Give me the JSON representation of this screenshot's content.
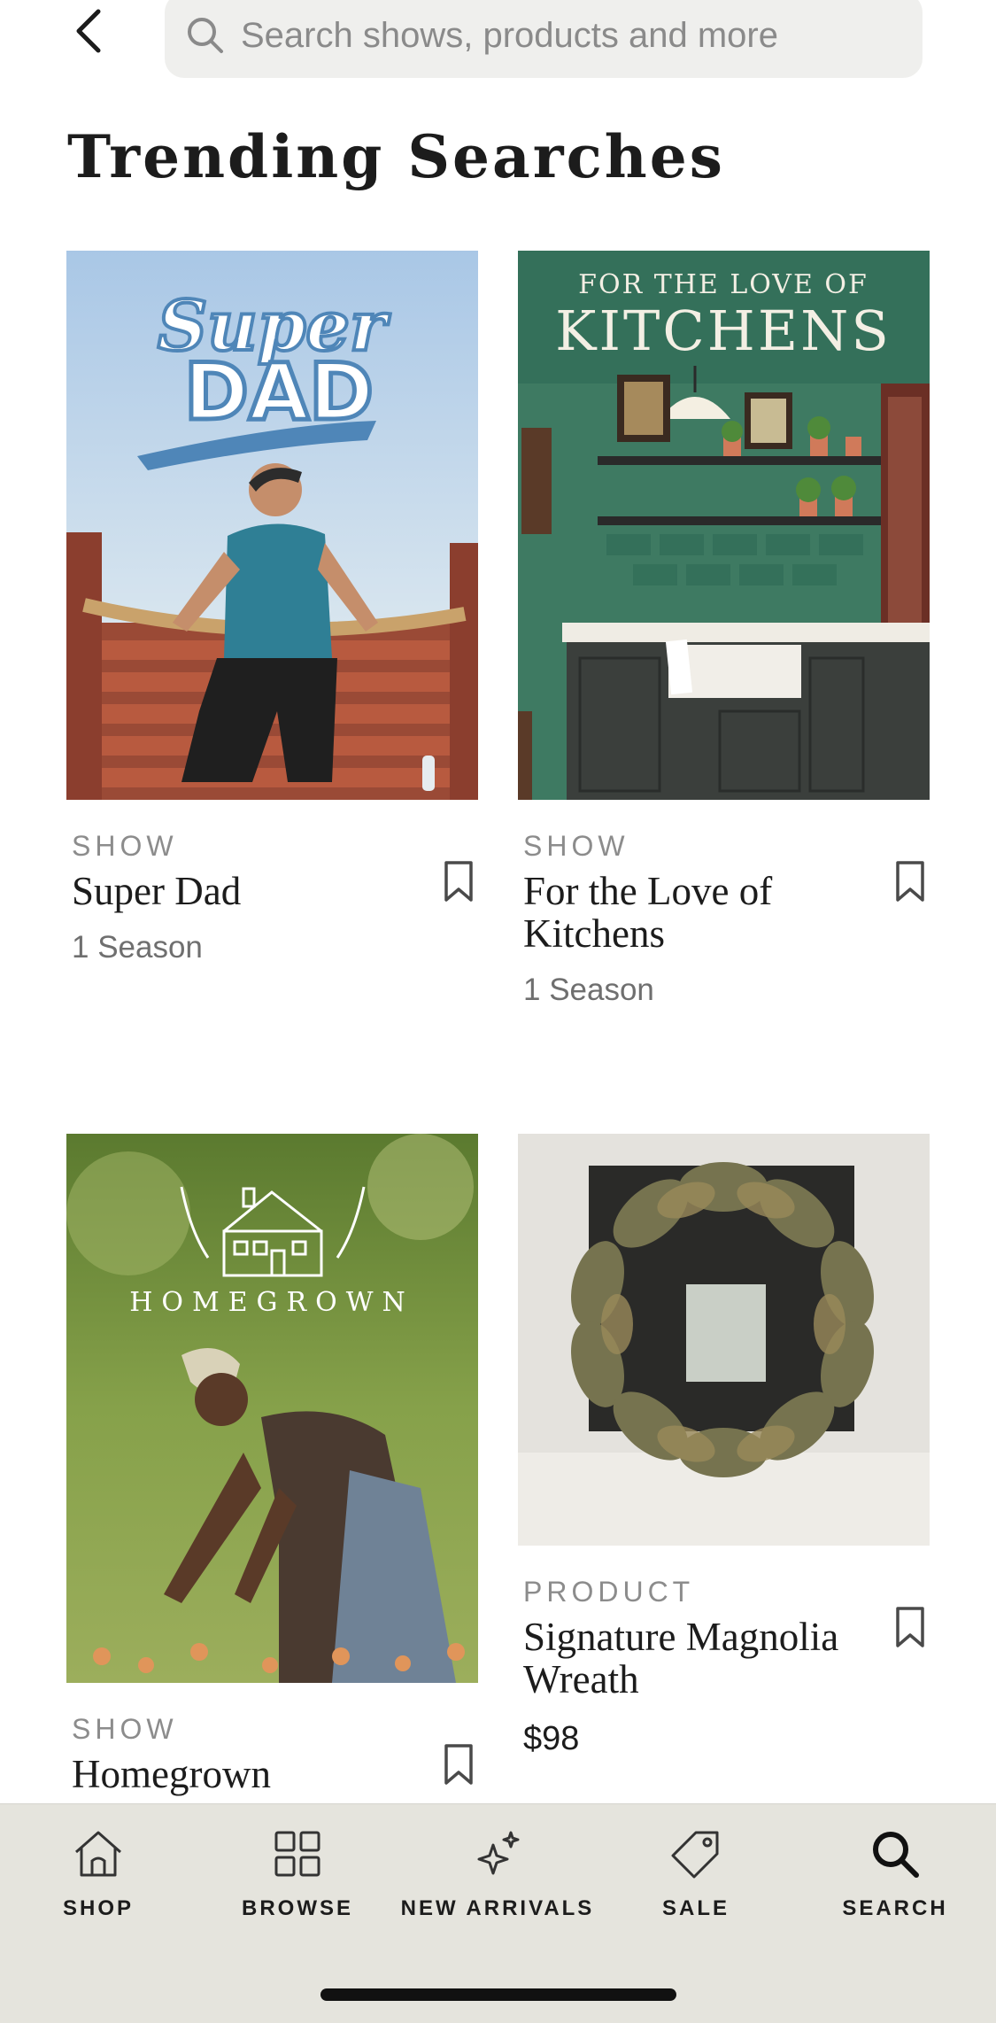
{
  "search": {
    "placeholder": "Search shows, products and more"
  },
  "page_title": "Trending Searches",
  "cards": [
    {
      "kind": "SHOW",
      "title": "Super Dad",
      "subtitle": "1 Season",
      "art_text": [
        "Super",
        "DAD"
      ]
    },
    {
      "kind": "SHOW",
      "title": "For the Love of Kitchens",
      "subtitle": "1 Season",
      "art_text": [
        "FOR THE LOVE OF",
        "KITCHENS"
      ]
    },
    {
      "kind": "SHOW",
      "title": "Homegrown",
      "art_text": [
        "HOMEGROWN"
      ]
    },
    {
      "kind": "PRODUCT",
      "title": "Signature Magnolia Wreath",
      "price": "$98"
    }
  ],
  "nav": [
    {
      "label": "SHOP",
      "icon": "home-icon"
    },
    {
      "label": "BROWSE",
      "icon": "grid-icon"
    },
    {
      "label": "NEW ARRIVALS",
      "icon": "sparkle-icon"
    },
    {
      "label": "SALE",
      "icon": "tag-icon"
    },
    {
      "label": "SEARCH",
      "icon": "search-icon"
    }
  ],
  "colors": {
    "nav_bg": "#e5e4dd",
    "search_bg": "#efefed",
    "kitchen_green": "#3e7a62"
  }
}
